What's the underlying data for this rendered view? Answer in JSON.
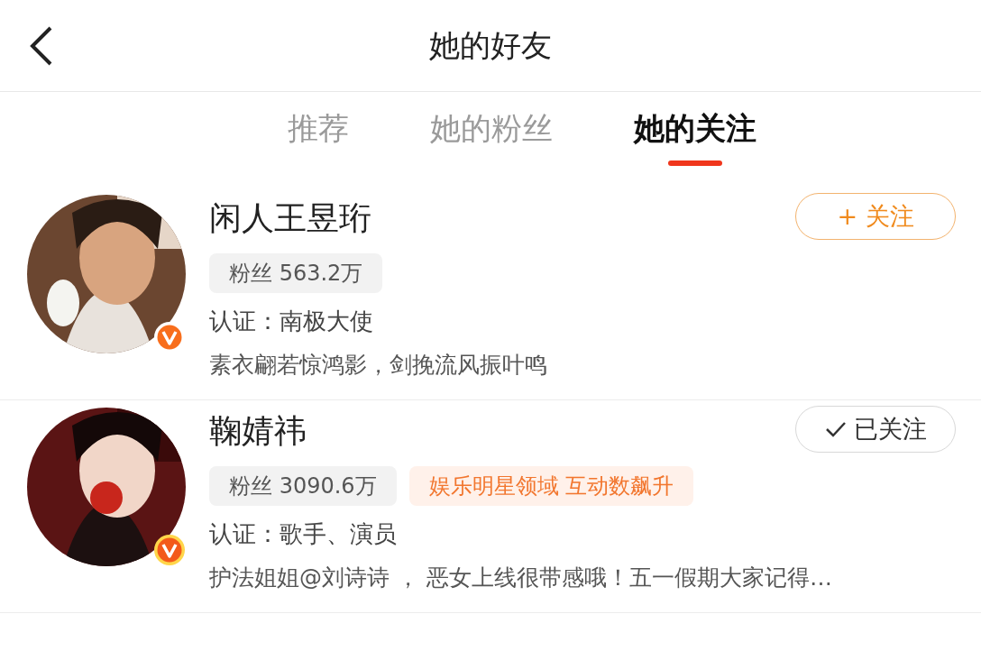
{
  "header": {
    "title": "她的好友"
  },
  "tabs": [
    {
      "label": "推荐",
      "selected": false
    },
    {
      "label": "她的粉丝",
      "selected": false
    },
    {
      "label": "她的关注",
      "selected": true
    }
  ],
  "users": [
    {
      "name": "闲人王昱珩",
      "badge": {
        "kind": "orange"
      },
      "followed": false,
      "follow_label": "+ 关注",
      "fans": "粉丝 563.2万",
      "verification": "认证：南极大使",
      "bio": "素衣翩若惊鸿影，剑挽流风振叶鸣"
    },
    {
      "name": "鞠婧祎",
      "badge": {
        "kind": "gold"
      },
      "followed": true,
      "follow_label": "已关注",
      "fans": "粉丝 3090.6万",
      "tags": [
        "娱乐明星领域 互动数飙升"
      ],
      "verification": "认证：歌手、演员",
      "bio": "护法姐姐@刘诗诗 ， 恶女上线很带感哦！五一假期大家记得…"
    }
  ]
}
